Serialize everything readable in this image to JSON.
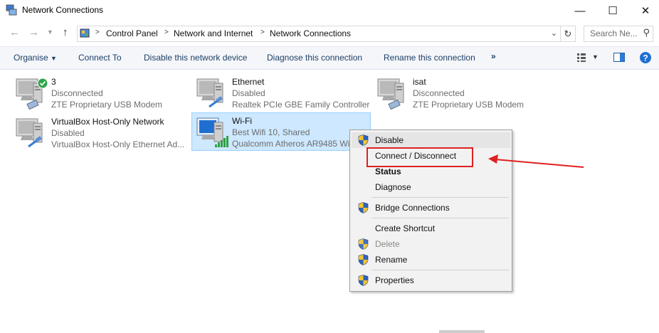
{
  "window": {
    "title": "Network Connections"
  },
  "address": {
    "crumbs": [
      "Control Panel",
      "Network and Internet",
      "Network Connections"
    ],
    "search_placeholder": "Search Ne..."
  },
  "commands": {
    "organise": "Organise",
    "connect_to": "Connect To",
    "disable_device": "Disable this network device",
    "diagnose": "Diagnose this connection",
    "rename": "Rename this connection",
    "more": "»"
  },
  "connections": [
    {
      "name": "3",
      "status": "Disconnected",
      "device": "ZTE Proprietary USB Modem",
      "icon": "modem-connected-icon"
    },
    {
      "name": "Ethernet",
      "status": "Disabled",
      "device": "Realtek PCIe GBE Family Controller",
      "icon": "ethernet-icon"
    },
    {
      "name": "isat",
      "status": "Disconnected",
      "device": "ZTE Proprietary USB Modem",
      "icon": "modem-icon"
    },
    {
      "name": "VirtualBox Host-Only Network",
      "status": "Disabled",
      "device": "VirtualBox Host-Only Ethernet Ad...",
      "icon": "ethernet-icon"
    },
    {
      "name": "Wi-Fi",
      "status": "Best Wifi  10, Shared",
      "device": "Qualcomm Atheros AR9485 Wi...",
      "icon": "wifi-icon"
    }
  ],
  "context_menu": {
    "disable": "Disable",
    "connect_disconnect": "Connect / Disconnect",
    "status": "Status",
    "diagnose": "Diagnose",
    "bridge": "Bridge Connections",
    "create_shortcut": "Create Shortcut",
    "delete": "Delete",
    "rename": "Rename",
    "properties": "Properties"
  },
  "colors": {
    "accent_blue": "#0078d7",
    "highlight_red": "#e02020",
    "selection_bg": "#cde8ff"
  }
}
